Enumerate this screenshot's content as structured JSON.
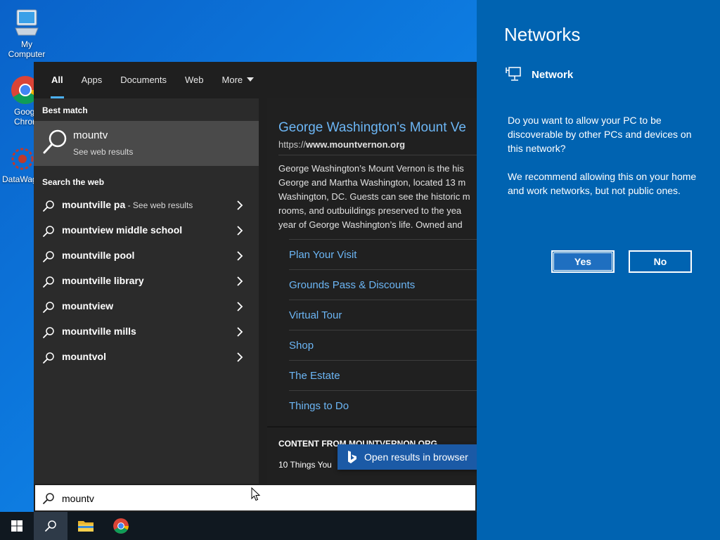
{
  "desktop": {
    "icons": [
      {
        "label": "My Computer"
      },
      {
        "label": "Goog\nChror"
      },
      {
        "label": "DataWag"
      }
    ]
  },
  "search": {
    "tabs": [
      "All",
      "Apps",
      "Documents",
      "Web",
      "More"
    ],
    "best_match_heading": "Best match",
    "best_match": {
      "title": "mountv",
      "subtitle": "See web results"
    },
    "search_web_heading": "Search the web",
    "suggestions": [
      {
        "text": "mountville pa",
        "extra": " - See web results"
      },
      {
        "text": "mountview middle school",
        "extra": ""
      },
      {
        "text": "mountville pool",
        "extra": ""
      },
      {
        "text": "mountville library",
        "extra": ""
      },
      {
        "text": "mountview",
        "extra": ""
      },
      {
        "text": "mountville mills",
        "extra": ""
      },
      {
        "text": "mountvol",
        "extra": ""
      }
    ],
    "query": "mountv"
  },
  "preview": {
    "title": "George Washington's Mount Ve",
    "url_prefix": "https://",
    "url_domain": "www.mountvernon.org",
    "description": [
      "George Washington’s Mount Vernon is the his",
      "George and Martha Washington, located 13 m",
      "Washington, DC. Guests can see the historic m",
      "rooms, and outbuildings preserved to the yea",
      "year of George Washington’s life. Owned and"
    ],
    "links": [
      "Plan Your Visit",
      "Grounds Pass & Discounts",
      "Virtual Tour",
      "Shop",
      "The Estate",
      "Things to Do"
    ],
    "content_from": "CONTENT FROM MOUNTVERNON.ORG",
    "content_item": "10 Things You",
    "open_browser": "Open results in browser"
  },
  "network": {
    "title": "Networks",
    "name": "Network",
    "question": "Do you want to allow your PC to be discoverable by other PCs and devices on this network?",
    "recommendation": "We recommend allowing this on your home and work networks, but not public ones.",
    "yes": "Yes",
    "no": "No"
  },
  "colors": {
    "accent": "#0063b1",
    "link": "#6cb6f5",
    "tab_underline": "#4cb0f2"
  }
}
